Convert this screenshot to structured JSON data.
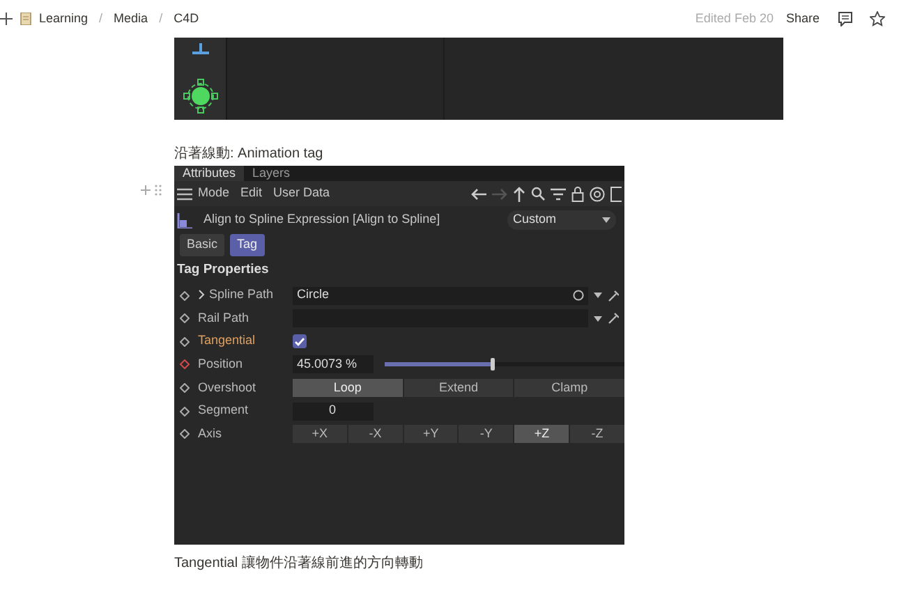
{
  "topbar": {
    "breadcrumb": [
      {
        "label": "Learning"
      },
      {
        "label": "Media"
      },
      {
        "label": "C4D"
      }
    ],
    "separator": "/",
    "edited": "Edited Feb 20",
    "share": "Share"
  },
  "caption_top": "沿著線動: Animation tag",
  "panel": {
    "tabs": [
      {
        "label": "Attributes",
        "selected": true
      },
      {
        "label": "Layers",
        "selected": false
      }
    ],
    "menu": [
      "Mode",
      "Edit",
      "User Data"
    ],
    "object_title": "Align to Spline Expression [Align to Spline]",
    "preset": "Custom",
    "subtabs": [
      {
        "label": "Basic",
        "selected": false
      },
      {
        "label": "Tag",
        "selected": true
      }
    ],
    "section": "Tag Properties",
    "params": [
      {
        "kind": "link",
        "label": "Spline Path",
        "expanded": false,
        "value": "Circle",
        "keyed": false,
        "modified": false
      },
      {
        "kind": "link",
        "label": "Rail Path",
        "keyed": false,
        "modified": false
      },
      {
        "kind": "checkbox",
        "label": "Tangential",
        "checked": true,
        "keyed": false,
        "modified": true
      },
      {
        "kind": "slider",
        "label": "Position",
        "value": "45.0073 %",
        "level": 0.45,
        "keyed": true,
        "modified": false
      },
      {
        "kind": "choice",
        "label": "Overshoot",
        "keyed": false,
        "modified": false,
        "options": [
          {
            "label": "Loop",
            "selected": true
          },
          {
            "label": "Extend",
            "selected": false
          },
          {
            "label": "Clamp",
            "selected": false
          }
        ]
      },
      {
        "kind": "number",
        "label": "Segment",
        "value": "0",
        "keyed": false,
        "modified": false
      },
      {
        "kind": "choice",
        "label": "Axis",
        "keyed": false,
        "modified": false,
        "options": [
          {
            "label": "+X",
            "selected": false
          },
          {
            "label": "-X",
            "selected": false
          },
          {
            "label": "+Y",
            "selected": false
          },
          {
            "label": "-Y",
            "selected": false
          },
          {
            "label": "+Z",
            "selected": true
          },
          {
            "label": "-Z",
            "selected": false
          }
        ]
      }
    ]
  },
  "caption_bottom": "Tangential 讓物件沿著線前進的方向轉動"
}
